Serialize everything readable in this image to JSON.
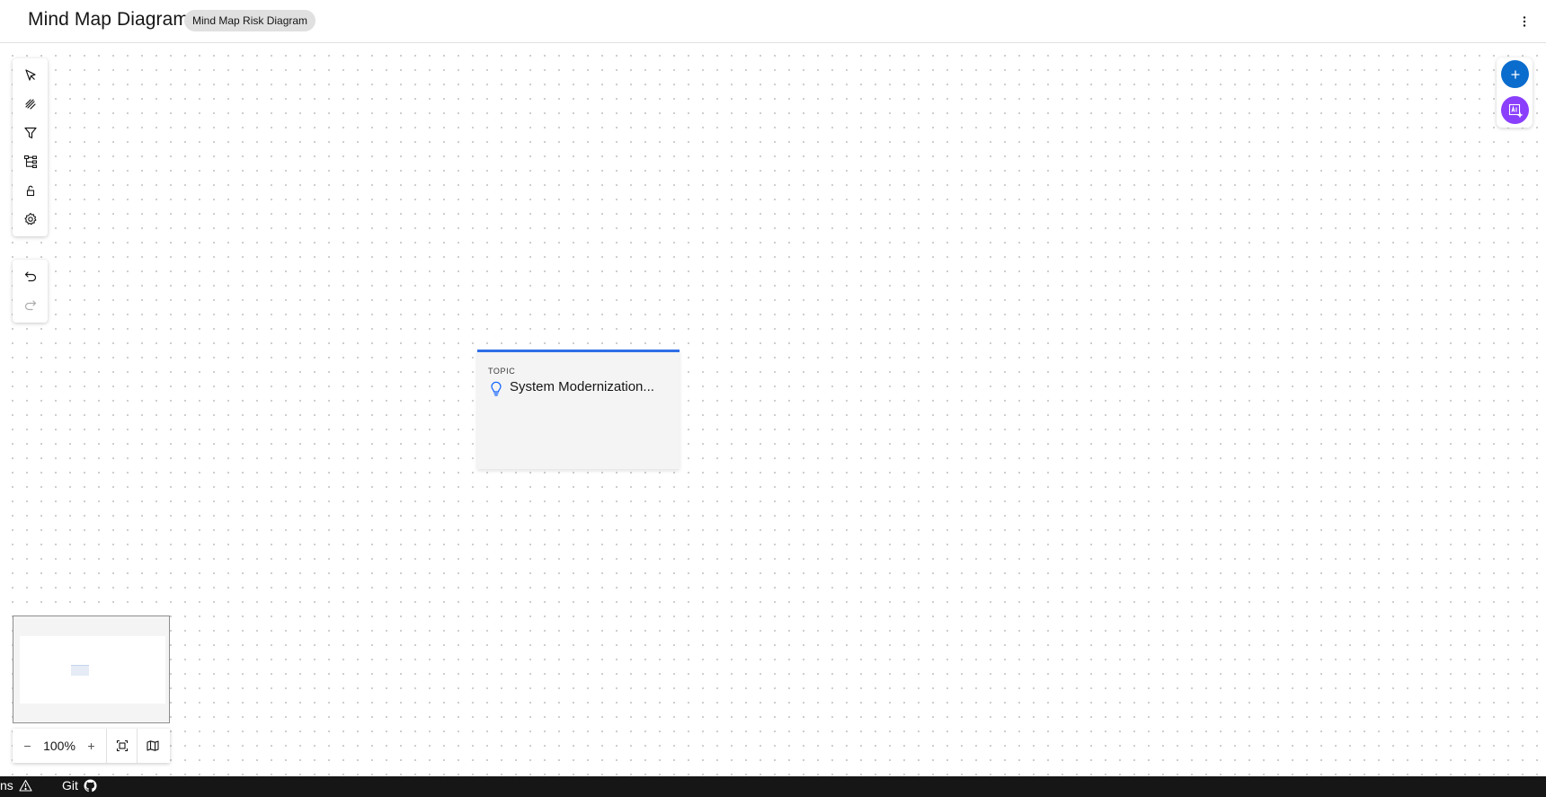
{
  "header": {
    "title": "Mind Map Diagram",
    "tag": "Mind Map Risk Diagram",
    "overflow_icon": "overflow-menu-vertical-icon"
  },
  "toolbar": {
    "tools": [
      {
        "name": "select-tool",
        "icon": "cursor-arrow-icon"
      },
      {
        "name": "connector-tool",
        "icon": "pen-strokes-icon"
      },
      {
        "name": "filter-tool",
        "icon": "filter-icon"
      },
      {
        "name": "tree-layout-tool",
        "icon": "tree-view-icon"
      },
      {
        "name": "lock-tool",
        "icon": "unlock-icon"
      },
      {
        "name": "settings-tool",
        "icon": "gear-icon"
      }
    ],
    "history": [
      {
        "name": "undo",
        "icon": "undo-icon"
      },
      {
        "name": "redo",
        "icon": "redo-icon",
        "disabled": true
      }
    ]
  },
  "right_panel": {
    "add_icon": "plus-icon",
    "ai_icon": "ai-generate-icon",
    "add_color": "#0a6ccd",
    "ai_color": "#8a3ffc"
  },
  "node": {
    "type_label": "TOPIC",
    "title": "System Modernization...",
    "icon": "lightbulb-icon",
    "accent_color": "#2f6fe6"
  },
  "zoom": {
    "minus": "−",
    "value": "100%",
    "plus": "+",
    "fit_icon": "fit-to-screen-icon",
    "map_icon": "map-icon"
  },
  "statusbar": {
    "left_text": "ns",
    "warning_icon": "warning-triangle-icon",
    "git_label": "Git",
    "github_icon": "github-icon"
  }
}
